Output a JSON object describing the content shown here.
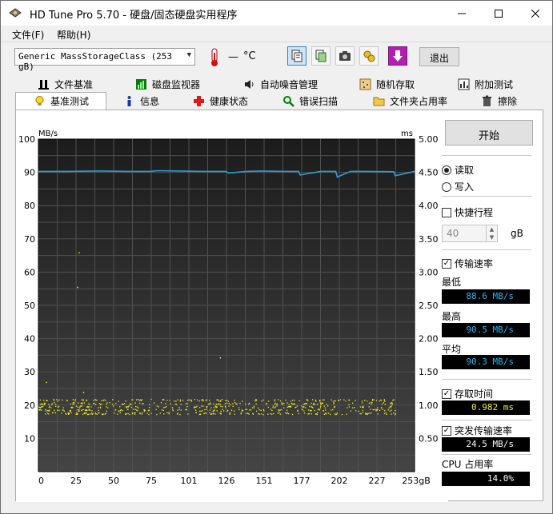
{
  "window": {
    "title": "HD Tune Pro 5.70 - 硬盘/固态硬盘实用程序"
  },
  "menu": {
    "file": "文件(F)",
    "help": "帮助(H)"
  },
  "toolbar": {
    "drive": "Generic MassStorageClass (253 gB)",
    "temp_value": "—",
    "temp_unit": "°C",
    "exit_label": "退出"
  },
  "tabs": {
    "row1": [
      "文件基准",
      "磁盘监视器",
      "自动噪音管理",
      "随机存取",
      "附加测试"
    ],
    "row2": [
      "基准测试",
      "信息",
      "健康状态",
      "错误扫描",
      "文件夹占用率",
      "擦除"
    ],
    "active": "基准测试"
  },
  "controls": {
    "start_label": "开始",
    "read_label": "读取",
    "write_label": "写入",
    "mode": "read",
    "short_stroke_label": "快捷行程",
    "short_stroke_checked": false,
    "short_stroke_value": "40",
    "short_stroke_unit": "gB",
    "transfer_rate_label": "传输速率",
    "transfer_rate_checked": true,
    "access_time_label": "存取时间",
    "access_time_checked": true,
    "burst_label": "突发传输速率",
    "burst_checked": true
  },
  "stats": {
    "min_label": "最低",
    "min_value": "88.6 MB/s",
    "max_label": "最高",
    "max_value": "90.5 MB/s",
    "avg_label": "平均",
    "avg_value": "90.3 MB/s",
    "access_value": "0.982 ms",
    "burst_value": "24.5 MB/s",
    "cpu_label": "CPU 占用率",
    "cpu_value": "14.0%"
  },
  "chart_data": {
    "type": "line",
    "left_unit": "MB/s",
    "right_unit": "ms",
    "x_unit": "gB",
    "x_ticks": [
      0,
      25,
      50,
      75,
      101,
      126,
      151,
      177,
      202,
      227,
      253
    ],
    "y_ticks": [
      10,
      20,
      30,
      40,
      50,
      60,
      70,
      80,
      90,
      100
    ],
    "y2_ticks": [
      "0.50",
      "1.00",
      "1.50",
      "2.00",
      "2.50",
      "3.00",
      "3.50",
      "4.00",
      "4.50",
      "5.00"
    ],
    "ylim": [
      0,
      100
    ],
    "y2lim": [
      0,
      5
    ],
    "xlim": [
      0,
      253
    ],
    "grid": true,
    "colors": {
      "background": "#2b2b2b",
      "grid": "#505050",
      "transfer": "#2a9fd6",
      "access": "#f0ef20"
    },
    "transfer_series": {
      "name": "",
      "x": [
        0,
        20,
        40,
        60,
        75,
        80,
        95,
        110,
        126,
        128,
        140,
        150,
        165,
        175,
        176,
        190,
        200,
        201,
        210,
        220,
        239,
        240,
        253
      ],
      "y": [
        90.3,
        90.3,
        90.4,
        90.3,
        90.3,
        90.5,
        90.4,
        90.3,
        90.3,
        89.8,
        90.3,
        90.4,
        90.3,
        90.3,
        89.2,
        90.3,
        90.3,
        88.6,
        90.3,
        90.3,
        90.2,
        89.0,
        90.3
      ]
    },
    "access_series": {
      "name": "",
      "x_range": [
        0,
        240
      ],
      "bands_ms": [
        0.88,
        0.93,
        0.98,
        1.03,
        1.08
      ],
      "outliers": [
        [
          5,
          1.35
        ],
        [
          27,
          3.3
        ],
        [
          26,
          2.78
        ],
        [
          122,
          1.72
        ],
        [
          30,
          1.2
        ]
      ]
    }
  }
}
